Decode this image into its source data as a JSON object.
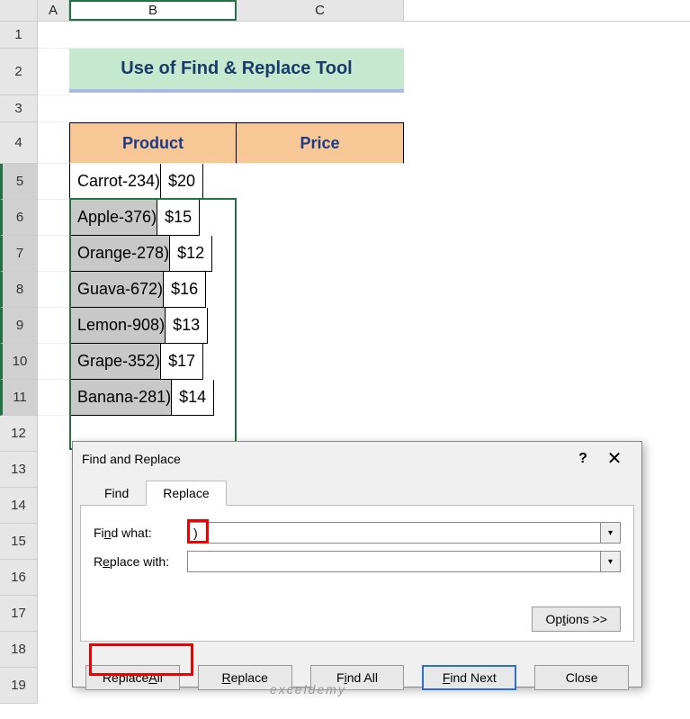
{
  "columns": {
    "a": "A",
    "b": "B",
    "c": "C"
  },
  "row_numbers": [
    "1",
    "2",
    "3",
    "4",
    "5",
    "6",
    "7",
    "8",
    "9",
    "10",
    "11",
    "12",
    "13",
    "14",
    "15",
    "16",
    "17",
    "18",
    "19"
  ],
  "title": "Use of Find & Replace Tool",
  "headers": {
    "product": "Product",
    "price": "Price"
  },
  "rows": [
    {
      "product": "Carrot-234)",
      "currency": "$",
      "price": "20"
    },
    {
      "product": "Apple-376)",
      "currency": "$",
      "price": "15"
    },
    {
      "product": "Orange-278)",
      "currency": "$",
      "price": "12"
    },
    {
      "product": "Guava-672)",
      "currency": "$",
      "price": "16"
    },
    {
      "product": "Lemon-908)",
      "currency": "$",
      "price": "13"
    },
    {
      "product": "Grape-352)",
      "currency": "$",
      "price": "17"
    },
    {
      "product": "Banana-281)",
      "currency": "$",
      "price": "14"
    }
  ],
  "dialog": {
    "title": "Find and Replace",
    "help": "?",
    "close": "✕",
    "tabs": {
      "find": "Find",
      "replace": "Replace"
    },
    "find_label_pre": "Fi",
    "find_label_u": "n",
    "find_label_post": "d what:",
    "replace_label_pre": "R",
    "replace_label_u": "e",
    "replace_label_post": "place with:",
    "find_value": ")",
    "replace_value": "",
    "options_pre": "Op",
    "options_u": "t",
    "options_post": "ions >>",
    "buttons": {
      "replace_all_pre": "Replace ",
      "replace_all_u": "A",
      "replace_all_post": "ll",
      "replace_u": "R",
      "replace_post": "eplace",
      "find_all_pre": "F",
      "find_all_u": "i",
      "find_all_post": "nd All",
      "find_next_u": "F",
      "find_next_post": "ind Next",
      "close": "Close"
    }
  },
  "watermark": "exceldemy"
}
